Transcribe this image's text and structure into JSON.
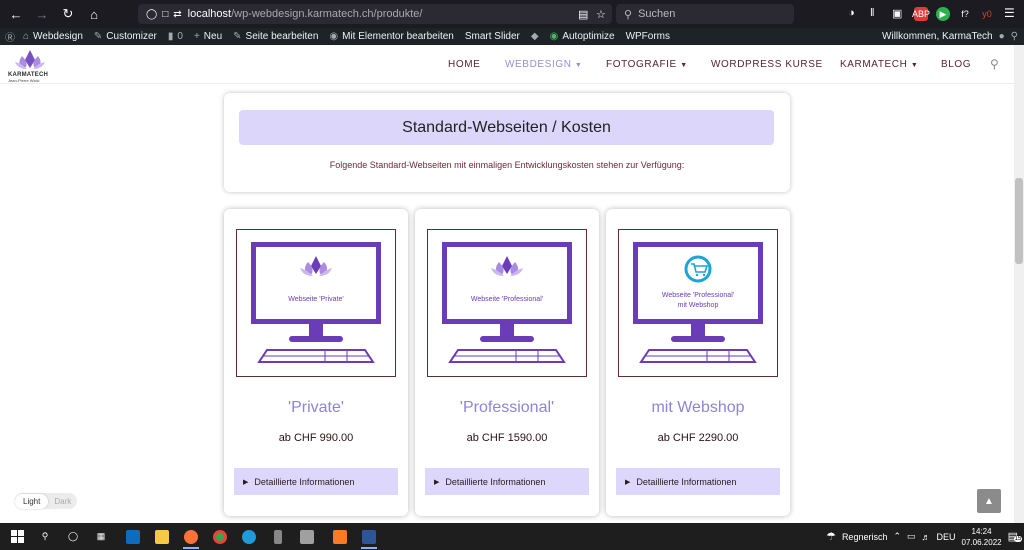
{
  "browser": {
    "url_host": "localhost",
    "url_path": "/wp-webdesign.karmatech.ch/produkte/",
    "search_placeholder": "Suchen",
    "ext_labels": [
      "ABP",
      "f?",
      "y0"
    ]
  },
  "adminbar": {
    "items": [
      "Webdesign",
      "Customizer",
      "0",
      "Neu",
      "Seite bearbeiten",
      "Mit Elementor bearbeiten",
      "Smart Slider",
      "Autoptimize",
      "WPForms"
    ],
    "greeting": "Willkommen, KarmaTech"
  },
  "site": {
    "logo_name": "KARMATECH",
    "logo_sub": "Jean-Pierre Wicki",
    "nav": [
      {
        "label": "HOME"
      },
      {
        "label": "WEBDESIGN"
      },
      {
        "label": "FOTOGRAFIE"
      },
      {
        "label": "WORDPRESS KURSE"
      },
      {
        "label": "KARMATECH"
      },
      {
        "label": "BLOG"
      }
    ]
  },
  "intro": {
    "title": "Standard-Webseiten / Kosten",
    "text": "Folgende Standard-Webseiten mit einmaligen Entwicklungskosten stehen zur Verfügung:"
  },
  "cards": [
    {
      "screen_line1": "Webseite 'Private'",
      "screen_line2": "",
      "title": "'Private'",
      "price": "ab CHF 990.00",
      "button": "Detaillierte Informationen"
    },
    {
      "screen_line1": "Webseite 'Professional'",
      "screen_line2": "",
      "title": "'Professional'",
      "price": "ab CHF 1590.00",
      "button": "Detaillierte Informationen"
    },
    {
      "screen_line1": "Webseite 'Professional'",
      "screen_line2": "mit Webshop",
      "title": "mit Webshop",
      "price": "ab CHF 2290.00",
      "button": "Detaillierte Informationen"
    }
  ],
  "mode_toggle": {
    "light": "Light",
    "dark": "Dark"
  },
  "taskbar": {
    "weather": "Regnerisch",
    "lang": "DEU",
    "time": "14:24",
    "date": "07.06.2022",
    "notifications": "15"
  },
  "colors": {
    "accent": "#9b8bd6",
    "monitor": "#6a3cb8",
    "panel": "#dcd6fb",
    "text_dark_red": "#5a2333"
  }
}
